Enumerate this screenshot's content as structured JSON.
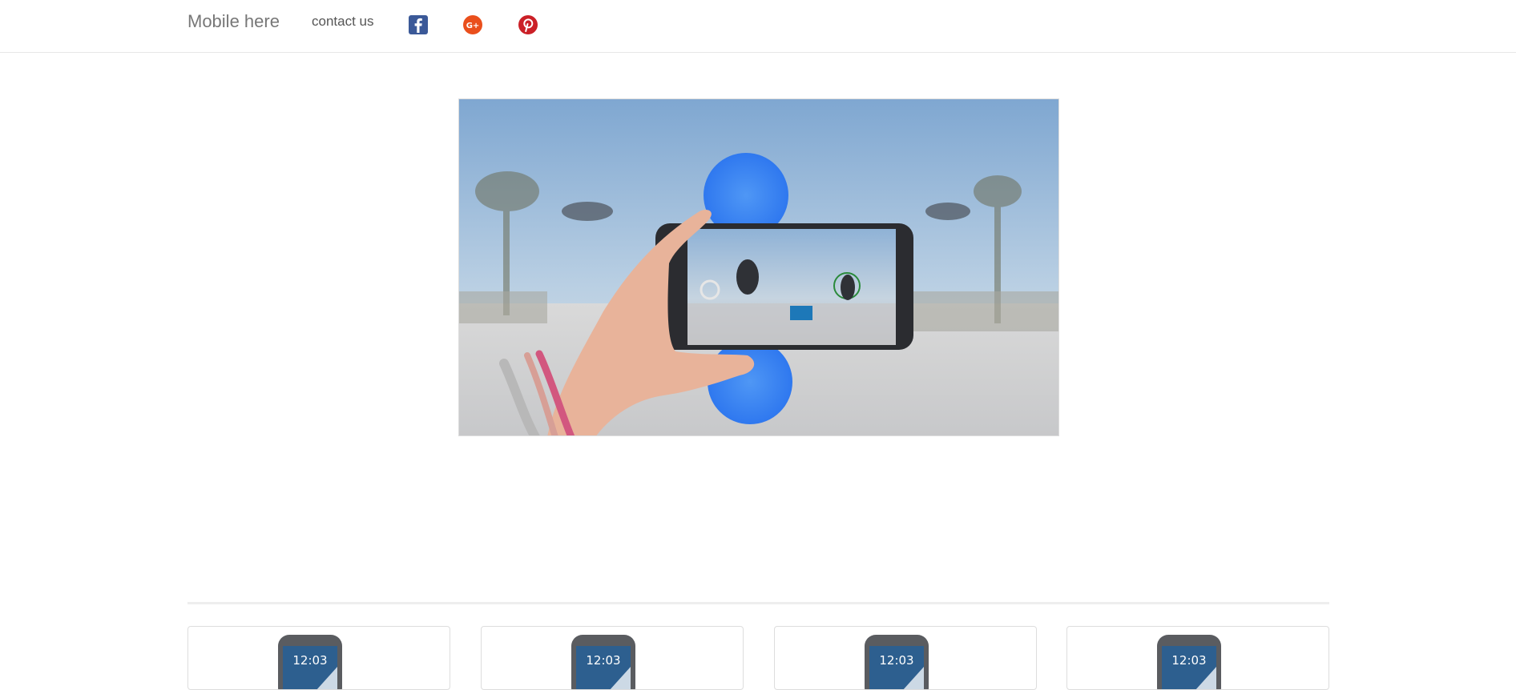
{
  "navbar": {
    "brand": "Mobile here",
    "contact_label": "contact us",
    "social": [
      "facebook-icon",
      "google-plus-icon",
      "pinterest-icon"
    ],
    "colors": {
      "facebook": "#3b5998",
      "google_plus": "#ea4f1c",
      "pinterest": "#cb2027"
    }
  },
  "hero": {
    "image": "hand holding a smartphone photographing a skateboarder"
  },
  "products": [
    {
      "screen_time": "12:03"
    },
    {
      "screen_time": "12:03"
    },
    {
      "screen_time": "12:03"
    },
    {
      "screen_time": "12:03"
    }
  ]
}
